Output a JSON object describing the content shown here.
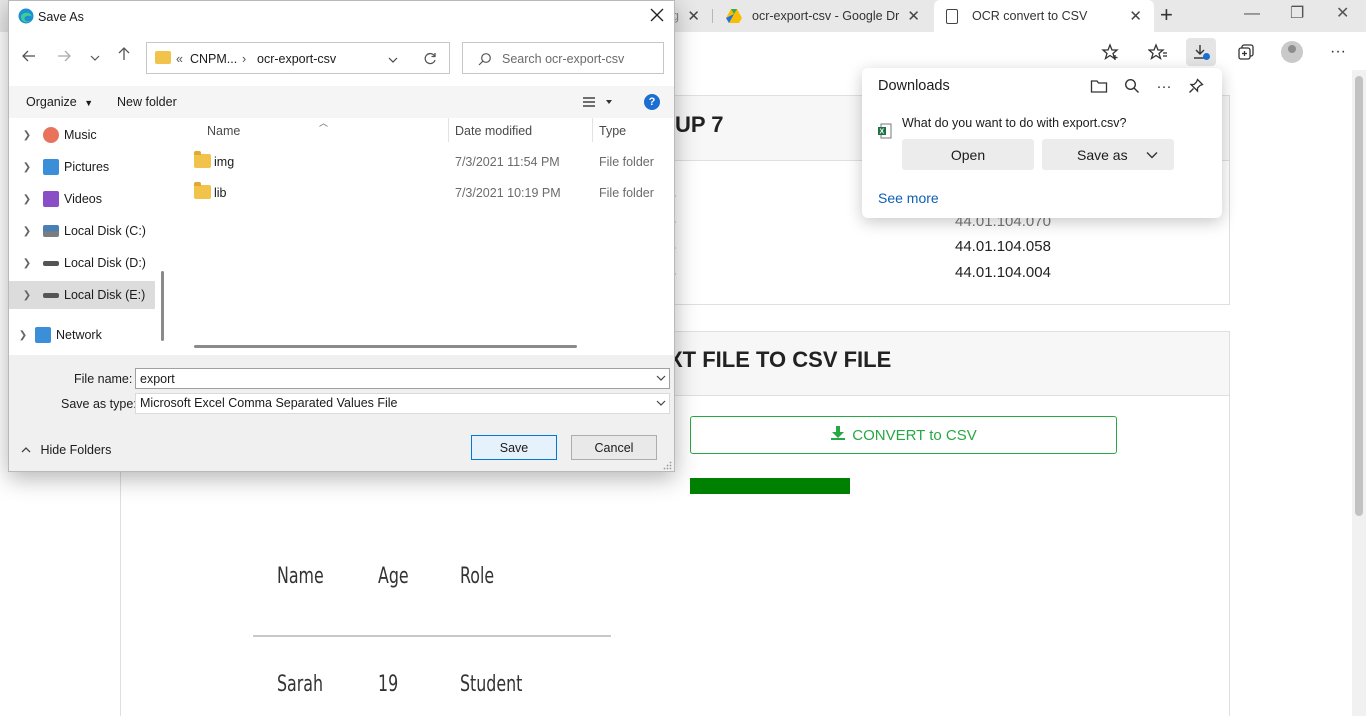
{
  "browser": {
    "tabs": [
      {
        "title": "gi",
        "close": "✕"
      },
      {
        "title": "ocr-export-csv - Google Drive",
        "close": "✕"
      },
      {
        "title": "OCR convert to CSV",
        "close": "✕"
      }
    ],
    "new_tab": "+",
    "window_controls": {
      "minimize": "—",
      "restore": "❐",
      "close": "✕"
    },
    "toolbar_icons": [
      "add-favorite-icon",
      "favorites-icon",
      "downloads-icon",
      "collections-icon",
      "profile-icon",
      "more-icon"
    ]
  },
  "page": {
    "card1_title": "UP 7",
    "list_values": [
      "44.01.104.070",
      "44.01.104.058",
      "44.01.104.004"
    ],
    "card2_title": "XT FILE TO CSV FILE",
    "convert_label": "CONVERT to CSV",
    "progress": 1.0,
    "handwriting": {
      "headers": [
        "Name",
        "Age",
        "Role"
      ],
      "row": [
        "Sarah",
        "19",
        "Student"
      ]
    }
  },
  "downloads": {
    "title": "Downloads",
    "question": "What do you want to do with export.csv?",
    "open_label": "Open",
    "save_as_label": "Save as",
    "see_more": "See more"
  },
  "dialog": {
    "title": "Save As",
    "breadcrumb": [
      "«",
      "CNPM...",
      "›",
      "ocr-export-csv"
    ],
    "search_placeholder": "Search ocr-export-csv",
    "organize": "Organize",
    "new_folder": "New folder",
    "help": "?",
    "nav_items": [
      {
        "label": "Music",
        "color": "#e8735a"
      },
      {
        "label": "Pictures",
        "color": "#3b8fd9"
      },
      {
        "label": "Videos",
        "color": "#8a4fc7"
      },
      {
        "label": "Local Disk (C:)",
        "color": "#4a7fb5"
      },
      {
        "label": "Local Disk (D:)",
        "color": "#555555"
      },
      {
        "label": "Local Disk (E:)",
        "color": "#555555"
      },
      {
        "label": "Network",
        "color": "#3b8fd9"
      }
    ],
    "columns": [
      "Name",
      "Date modified",
      "Type"
    ],
    "files": [
      {
        "name": "img",
        "date": "7/3/2021 11:54 PM",
        "type": "File folder"
      },
      {
        "name": "lib",
        "date": "7/3/2021 10:19 PM",
        "type": "File folder"
      }
    ],
    "file_name_label": "File name:",
    "file_name_value": "export",
    "save_type_label": "Save as type:",
    "save_type_value": "Microsoft Excel Comma Separated Values File",
    "hide_folders": "Hide Folders",
    "save_label": "Save",
    "cancel_label": "Cancel"
  }
}
